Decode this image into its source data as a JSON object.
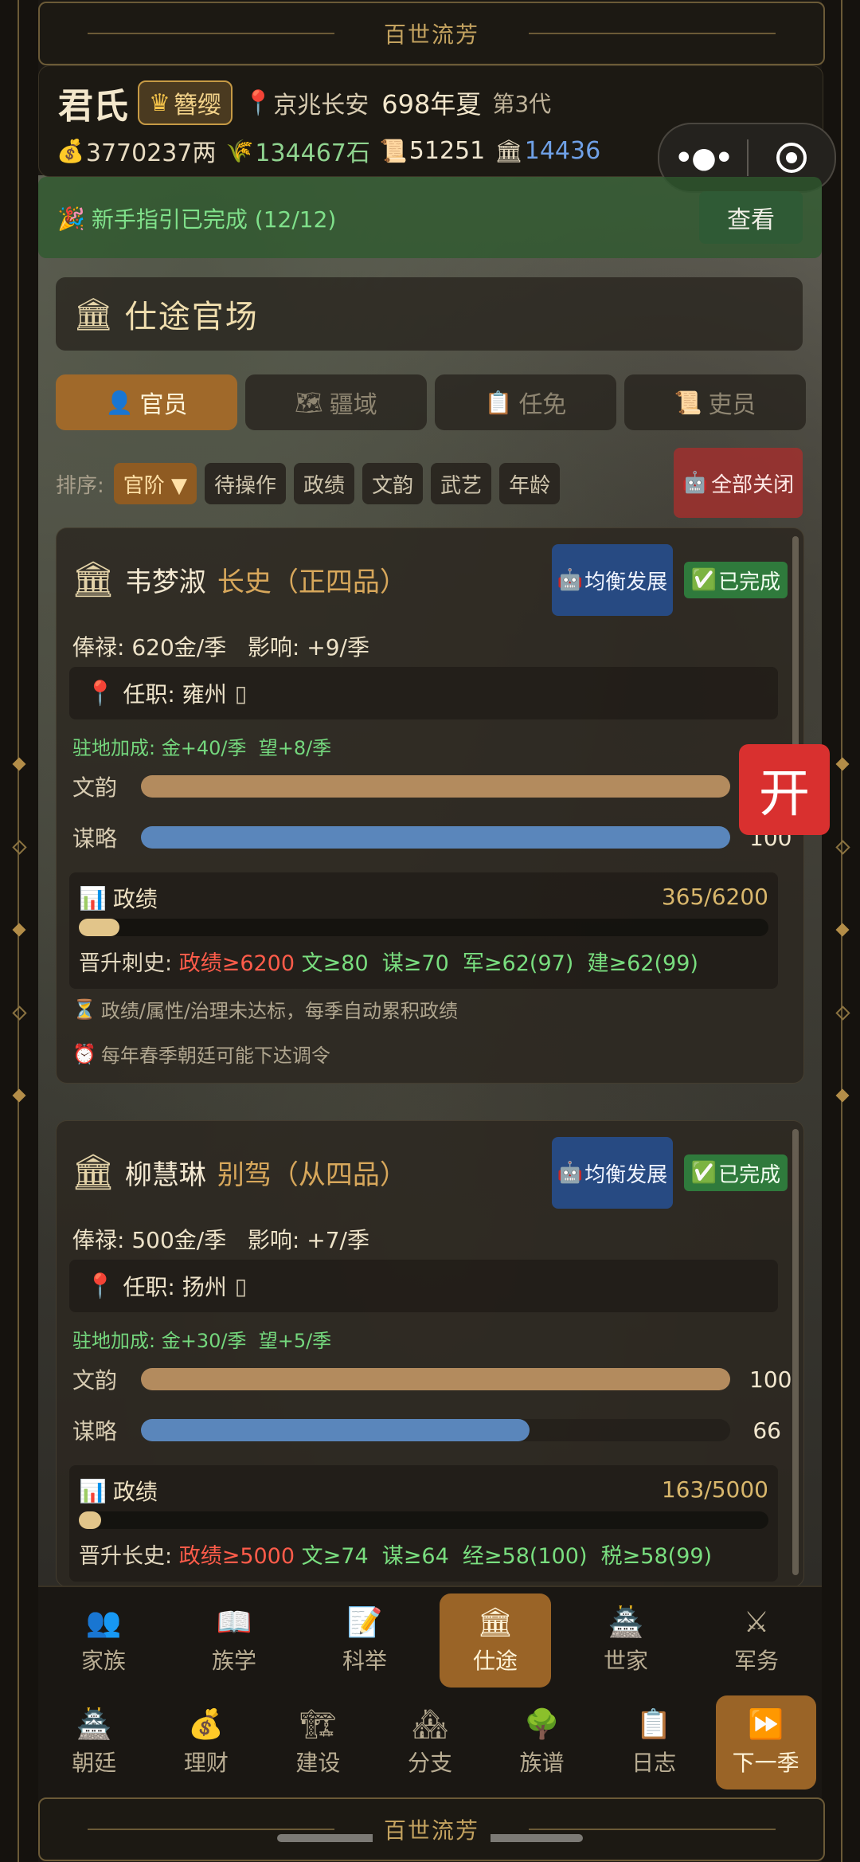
{
  "banner": {
    "top_text": "百世流芳",
    "bottom_text": "百世流芳"
  },
  "header": {
    "clan": "君氏",
    "rank_icon": "crown-icon",
    "rank": "簪缨",
    "location": "京兆长安",
    "season": "698年夏",
    "generation": "第3代",
    "resources": [
      {
        "icon": "money-bag-icon",
        "value": "3770237两",
        "color": "#e8dcc2"
      },
      {
        "icon": "grain-icon",
        "value": "134467石",
        "color": "#8fd38f"
      },
      {
        "icon": "scroll-icon",
        "value": "51251",
        "color": "#f0e6d0"
      },
      {
        "icon": "temple-icon",
        "value": "14436",
        "color": "#6fa0e6"
      }
    ]
  },
  "guide": {
    "text": "新手指引已完成 (12/12)",
    "button": "查看"
  },
  "section": {
    "title": "仕途官场"
  },
  "tabs": [
    {
      "label": "官员",
      "icon": "person-icon",
      "active": true
    },
    {
      "label": "疆域",
      "icon": "map-icon",
      "active": false
    },
    {
      "label": "任免",
      "icon": "clipboard-icon",
      "active": false
    },
    {
      "label": "吏员",
      "icon": "scroll-icon",
      "active": false
    }
  ],
  "sort": {
    "label": "排序:",
    "options": [
      "官阶 ▼",
      "待操作",
      "政绩",
      "文韵",
      "武艺",
      "年龄"
    ],
    "close_all": "全部关闭"
  },
  "officials": [
    {
      "name": "韦梦淑",
      "post": "长史（正四品）",
      "auto_button": "均衡发展",
      "status": "已完成",
      "salary": "俸禄: 620金/季   影响: +9/季",
      "office": "任职: 雍州",
      "bonus": "驻地加成: 金+40/季  望+8/季",
      "attrs": [
        {
          "label": "文韵",
          "value": 100,
          "display": "",
          "color": "#b38b5e"
        },
        {
          "label": "谋略",
          "value": 100,
          "display": "100",
          "color": "#5a86bb"
        }
      ],
      "perf_title": "政绩",
      "perf_value": "365/6200",
      "perf_ratio": 0.0589,
      "promo_prefix": "晋升刺史:",
      "promo_red": "政绩≥6200",
      "promo_green": "文≥80  谋≥70  军≥62(97)  建≥62(99)",
      "notes": [
        "政绩/属性/治理未达标，每季自动累积政绩",
        "每年春季朝廷可能下达调令"
      ]
    },
    {
      "name": "柳慧琳",
      "post": "别驾（从四品）",
      "auto_button": "均衡发展",
      "status": "已完成",
      "salary": "俸禄: 500金/季   影响: +7/季",
      "office": "任职: 扬州",
      "bonus": "驻地加成: 金+30/季  望+5/季",
      "attrs": [
        {
          "label": "文韵",
          "value": 100,
          "display": "100",
          "color": "#b38b5e"
        },
        {
          "label": "谋略",
          "value": 66,
          "display": "66",
          "color": "#5a86bb"
        }
      ],
      "perf_title": "政绩",
      "perf_value": "163/5000",
      "perf_ratio": 0.0326,
      "promo_prefix": "晋升长史:",
      "promo_red": "政绩≥5000",
      "promo_green": "文≥74  谋≥64  经≥58(100)  税≥58(99)",
      "notes": []
    }
  ],
  "floating": {
    "open_label": "开"
  },
  "nav_row1": [
    {
      "label": "家族",
      "icon": "family-icon",
      "glyph": "👥",
      "active": false
    },
    {
      "label": "族学",
      "icon": "book-icon",
      "glyph": "📖",
      "active": false
    },
    {
      "label": "科举",
      "icon": "memo-icon",
      "glyph": "📝",
      "active": false
    },
    {
      "label": "仕途",
      "icon": "temple-icon",
      "glyph": "🏛",
      "active": true
    },
    {
      "label": "世家",
      "icon": "castle-icon",
      "glyph": "🏯",
      "active": false
    },
    {
      "label": "军务",
      "icon": "swords-icon",
      "glyph": "⚔",
      "active": false
    }
  ],
  "nav_row2": [
    {
      "label": "朝廷",
      "icon": "palace-icon",
      "glyph": "🏯",
      "active": false
    },
    {
      "label": "理财",
      "icon": "money-bag-icon",
      "glyph": "💰",
      "active": false
    },
    {
      "label": "建设",
      "icon": "crane-icon",
      "glyph": "🏗",
      "active": false
    },
    {
      "label": "分支",
      "icon": "houses-icon",
      "glyph": "🏘",
      "active": false
    },
    {
      "label": "族谱",
      "icon": "tree-icon",
      "glyph": "🌳",
      "active": false
    },
    {
      "label": "日志",
      "icon": "clipboard-icon",
      "glyph": "📋",
      "active": false
    },
    {
      "label": "下一季",
      "icon": "fast-forward-icon",
      "glyph": "⏩",
      "active": true
    }
  ]
}
